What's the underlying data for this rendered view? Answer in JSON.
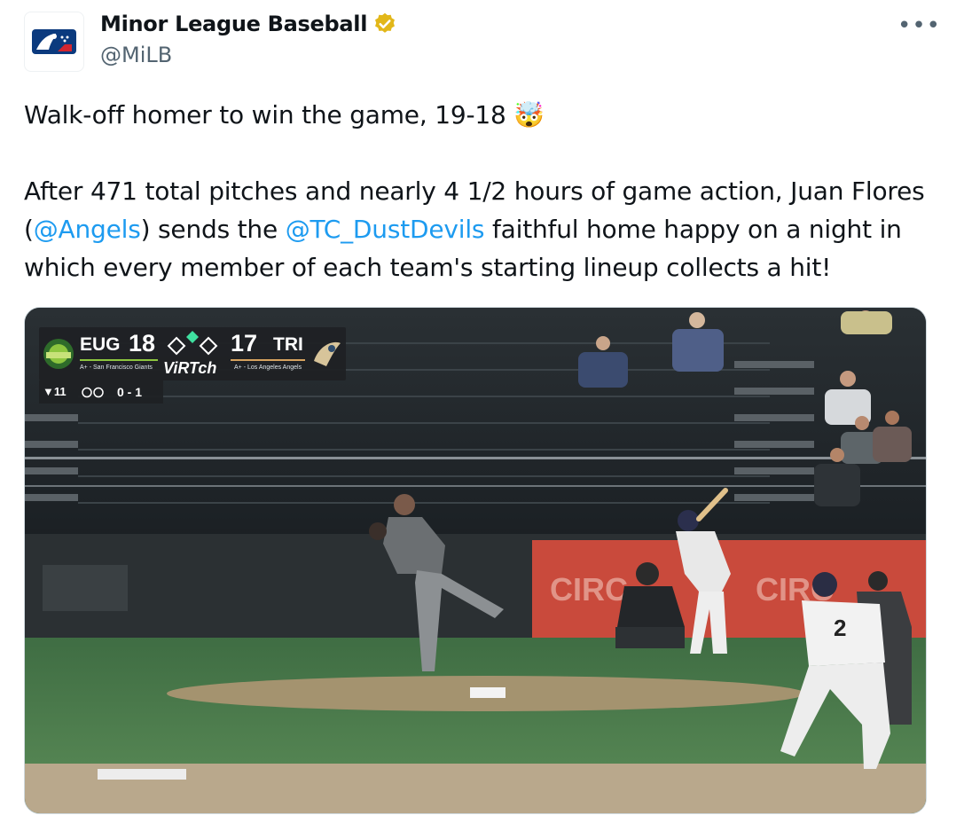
{
  "author": {
    "name": "Minor League Baseball",
    "handle": "@MiLB",
    "verified_icon": "gold-verified-badge-icon",
    "avatar_icon": "milb-logo-icon"
  },
  "more_label": "•••",
  "tweet": {
    "line1": "Walk-off homer to win the game, 19-18 🤯",
    "p2_a": "After 471 total pitches and nearly 4 1/2 hours of game action, Juan Flores (",
    "mention1": "@Angels",
    "p2_b": ") sends the ",
    "mention2": "@TC_DustDevils",
    "p2_c": " faithful home happy on a night in which every member of each team's starting lineup collects a hit!"
  },
  "scorebug": {
    "away_abbr": "EUG",
    "away_score": "18",
    "away_affil": "A+ - San Francisco Giants",
    "home_score": "17",
    "home_abbr": "TRI",
    "home_affil": "A+ - Los Angeles Angels",
    "network": "ViRTch",
    "inning": "▼11",
    "count": "0 - 1"
  },
  "colors": {
    "link": "#1d9bf0",
    "secondary_text": "#536471",
    "verified_gold": "#e2b719",
    "away_accent": "#8dc63f",
    "home_accent": "#d7a35f"
  },
  "scene": {
    "player_number": "2",
    "banner_text": "CIRC"
  }
}
